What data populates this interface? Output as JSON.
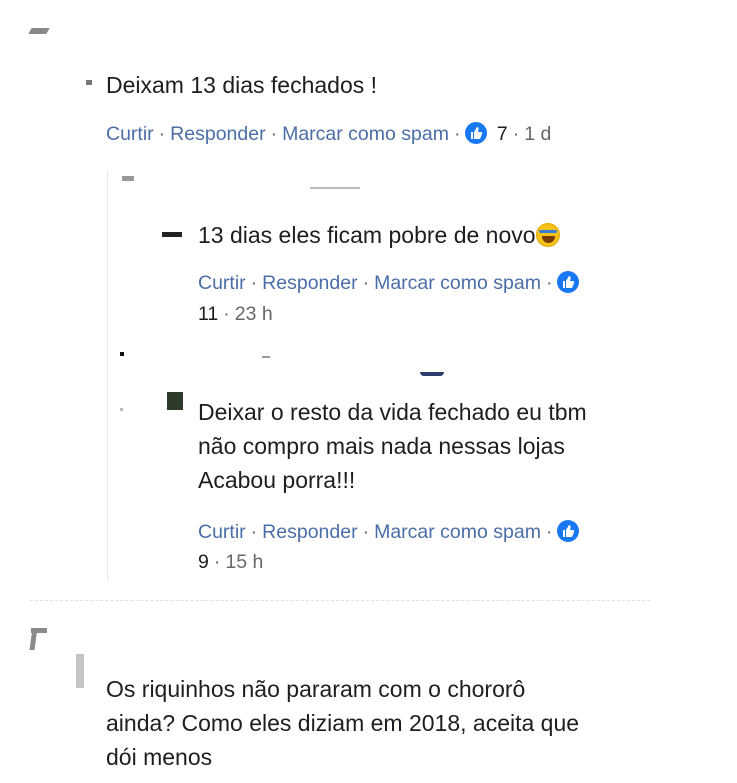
{
  "comment1": {
    "text": "Deixam 13 dias fechados !",
    "actions": {
      "like": "Curtir",
      "reply": "Responder",
      "spam": "Marcar como spam",
      "sep": "·"
    },
    "reactions": "7",
    "time": "1 d"
  },
  "reply1": {
    "text": "13 dias eles ficam pobre de novo",
    "emoji": "rolling-on-floor-laughing-emoji",
    "actions": {
      "like": "Curtir",
      "reply": "Responder",
      "spam": "Marcar como spam",
      "sep": "·"
    },
    "reactions": "11",
    "time": "23 h"
  },
  "reply2": {
    "lines": [
      "Deixar o resto da vida fechado eu tbm",
      "não compro mais nada nessas lojas",
      "Acabou porra!!!"
    ],
    "actions": {
      "like": "Curtir",
      "reply": "Responder",
      "spam": "Marcar como spam",
      "sep": "·"
    },
    "reactions": "9",
    "time": "15 h"
  },
  "comment2": {
    "lines": [
      "Os riquinhos não pararam com o chororô",
      "ainda? Como eles diziam em 2018, aceita que",
      "dói menos"
    ]
  },
  "colors": {
    "link": "#4b6ea8",
    "like_blue": "#1877f2",
    "meta": "#65676b"
  },
  "icons": {
    "reaction": "like-icon"
  }
}
